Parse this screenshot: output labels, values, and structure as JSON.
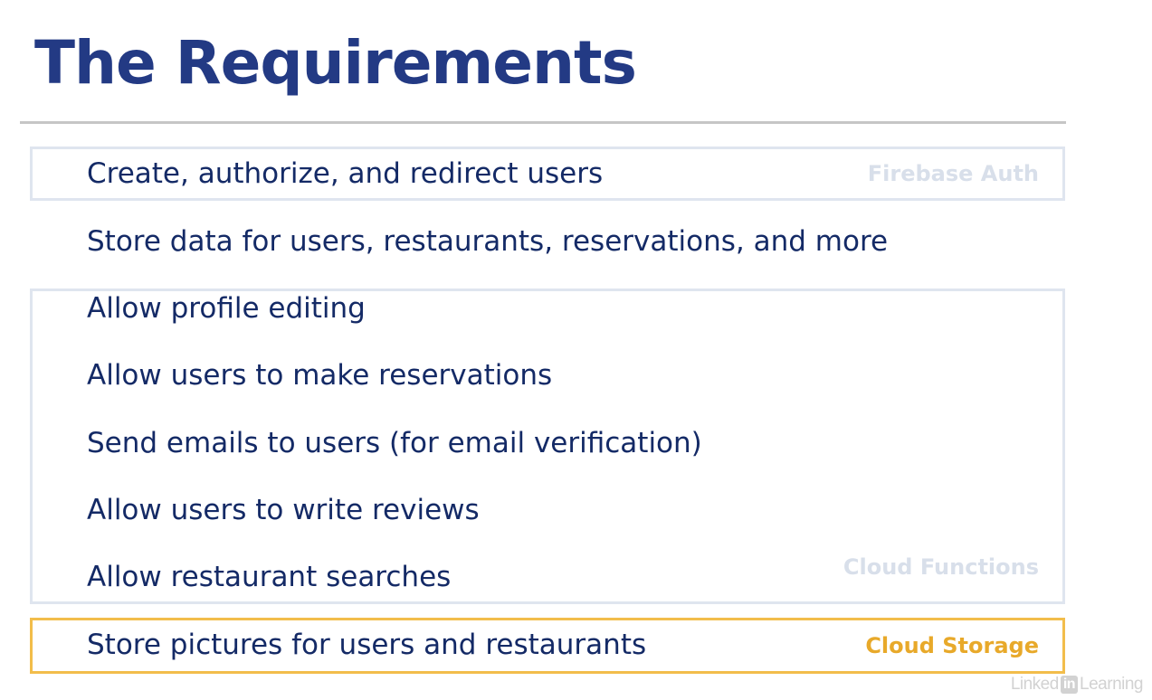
{
  "slide": {
    "title": "The Requirements",
    "requirements": [
      "Create, authorize, and redirect users",
      "Store data for users, restaurants, reservations, and more",
      "Allow profile editing",
      "Allow users to make reservations",
      "Send emails to users (for email verification)",
      "Allow users to write reviews",
      "Allow restaurant searches",
      "Store pictures for users and restaurants"
    ],
    "tags": {
      "auth": "Firebase Auth",
      "functions": "Cloud Functions",
      "storage": "Cloud Storage"
    }
  },
  "watermark": {
    "brand_prefix": "Linked",
    "brand_box": "in",
    "brand_suffix": "Learning"
  },
  "colors": {
    "title": "#233a84",
    "text": "#142a66",
    "muted_border": "#dfe5ef",
    "storage_accent": "#f2bd4b"
  }
}
